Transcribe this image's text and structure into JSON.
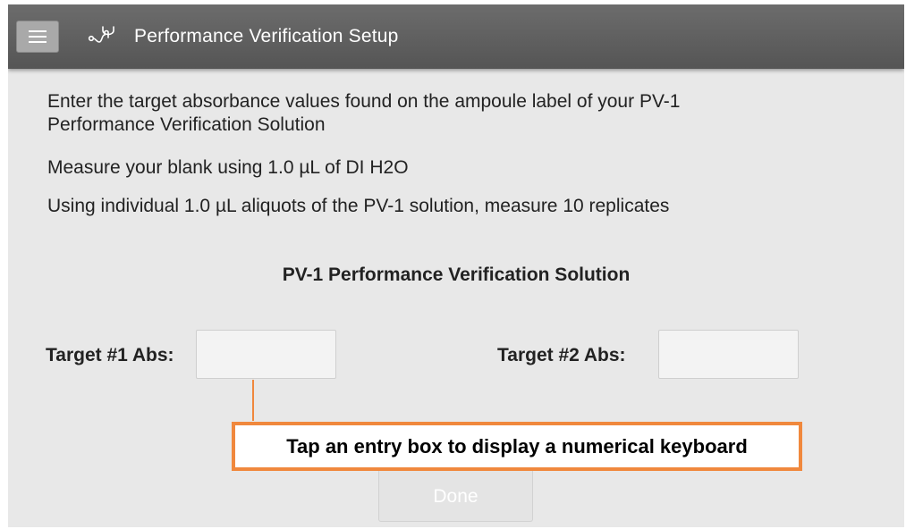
{
  "header": {
    "title": "Performance Verification Setup",
    "menu_icon": "hamburger-menu-icon",
    "app_icon": "stethoscope-icon",
    "bar_color": "#5f5f5f"
  },
  "instructions": {
    "line1": "Enter the target absorbance values found on the ampoule label of your PV-1",
    "line1_cont": "Performance Verification Solution",
    "line2": "Measure your blank using 1.0 µL of DI H2O",
    "line3": "Using individual 1.0 µL aliquots of the PV-1 solution, measure 10 replicates"
  },
  "section": {
    "title": "PV-1 Performance Verification Solution"
  },
  "targets": {
    "target1_label": "Target #1 Abs:",
    "target1_value": "",
    "target2_label": "Target #2 Abs:",
    "target2_value": ""
  },
  "callout": {
    "text": "Tap an entry box to display a numerical keyboard",
    "accent": "#f0883d"
  },
  "buttons": {
    "done_label": "Done"
  }
}
